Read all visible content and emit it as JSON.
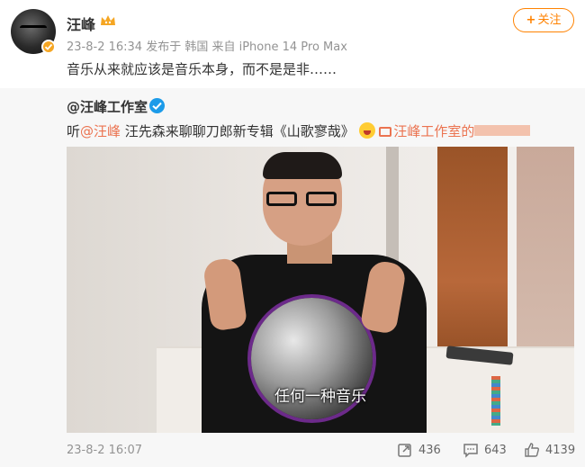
{
  "author": {
    "name": "汪峰",
    "meta": "23-8-2 16:34  发布于 韩国  来自 iPhone 14 Pro Max"
  },
  "follow_button": {
    "plus": "+",
    "label": "关注"
  },
  "post": {
    "text": "音乐从来就应该是音乐本身，而不是是非……"
  },
  "retweet": {
    "author": "@汪峰工作室",
    "text_prefix": "听",
    "mention": "@汪峰",
    "text_middle": " 汪先森来聊聊刀郎新专辑《山歌寥哉》",
    "link_text": "汪峰工作室的",
    "video_subtitle": "任何一种音乐",
    "time": "23-8-2 16:07",
    "counts": {
      "reposts": "436",
      "comments": "643",
      "likes": "4139"
    }
  },
  "colors": {
    "accent": "#ff8200",
    "link": "#eb7350",
    "verify_blue": "#1c9be9",
    "verify_gold": "#f5a623"
  },
  "icons": [
    "vip-crown-icon",
    "verified-icon",
    "emoji-laugh-icon",
    "video-icon",
    "repost-icon",
    "comment-icon",
    "like-icon"
  ]
}
